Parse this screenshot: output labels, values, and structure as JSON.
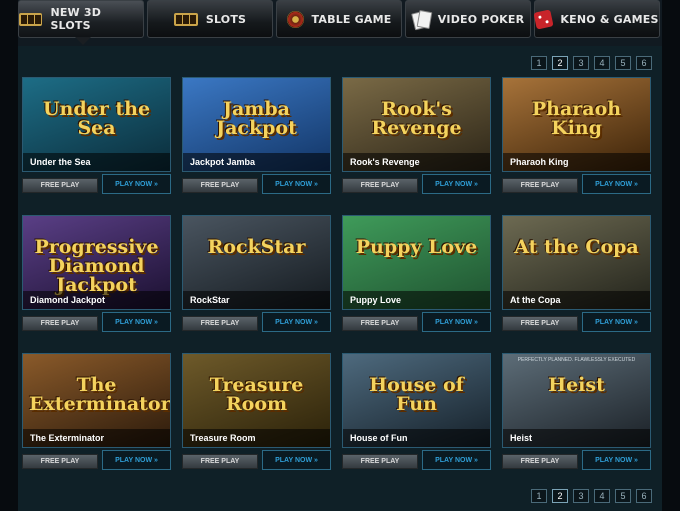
{
  "nav": {
    "tabs": [
      {
        "label": "New 3D Slots",
        "icon": "slot-777-icon",
        "active": true
      },
      {
        "label": "Slots",
        "icon": "slot-777-icon",
        "active": false
      },
      {
        "label": "Table Game",
        "icon": "roulette-icon",
        "active": false
      },
      {
        "label": "Video Poker",
        "icon": "cards-icon",
        "active": false
      },
      {
        "label": "Keno & Games",
        "icon": "dice-icon",
        "active": false
      }
    ]
  },
  "pagination": {
    "pages": [
      "1",
      "2",
      "3",
      "4",
      "5",
      "6"
    ],
    "current": "2"
  },
  "games": [
    {
      "title": "Under the Sea",
      "logo": "Under the Sea",
      "free_label": "FREE PLAY",
      "play_label": "PLAY NOW »",
      "bg_from": "#1d6d86",
      "bg_to": "#0b2c3a"
    },
    {
      "title": "Jackpot Jamba",
      "logo": "Jamba Jackpot",
      "free_label": "FREE PLAY",
      "play_label": "PLAY NOW »",
      "bg_from": "#3b78c4",
      "bg_to": "#123566"
    },
    {
      "title": "Rook's Revenge",
      "logo": "Rook's Revenge",
      "free_label": "FREE PLAY",
      "play_label": "PLAY NOW »",
      "bg_from": "#7a6a46",
      "bg_to": "#2c2517"
    },
    {
      "title": "Pharaoh King",
      "logo": "Pharaoh King",
      "free_label": "FREE PLAY",
      "play_label": "PLAY NOW »",
      "bg_from": "#a7733a",
      "bg_to": "#3b2208"
    },
    {
      "title": "Diamond Jackpot",
      "logo": "Progressive Diamond Jackpot",
      "free_label": "FREE PLAY",
      "play_label": "PLAY NOW »",
      "bg_from": "#5a3f86",
      "bg_to": "#1b1030"
    },
    {
      "title": "RockStar",
      "logo": "RockStar",
      "free_label": "FREE PLAY",
      "play_label": "PLAY NOW »",
      "bg_from": "#4a5560",
      "bg_to": "#141a1f"
    },
    {
      "title": "Puppy Love",
      "logo": "Puppy Love",
      "free_label": "FREE PLAY",
      "play_label": "PLAY NOW »",
      "bg_from": "#3f9b5a",
      "bg_to": "#1f5230"
    },
    {
      "title": "At the Copa",
      "logo": "At the Copa",
      "free_label": "FREE PLAY",
      "play_label": "PLAY NOW »",
      "bg_from": "#6d6a52",
      "bg_to": "#22231b"
    },
    {
      "title": "The Exterminator",
      "logo": "The Exterminator",
      "free_label": "FREE PLAY",
      "play_label": "PLAY NOW »",
      "bg_from": "#8a5a2a",
      "bg_to": "#2b1a0b"
    },
    {
      "title": "Treasure Room",
      "logo": "Treasure Room",
      "free_label": "FREE PLAY",
      "play_label": "PLAY NOW »",
      "bg_from": "#6e5a2a",
      "bg_to": "#2a2109"
    },
    {
      "title": "House of Fun",
      "logo": "House of Fun",
      "free_label": "FREE PLAY",
      "play_label": "PLAY NOW »",
      "bg_from": "#4e6a7e",
      "bg_to": "#152029"
    },
    {
      "title": "Heist",
      "logo": "Heist",
      "tagline": "PERFECTLY PLANNED. FLAWLESSLY EXECUTED",
      "free_label": "FREE PLAY",
      "play_label": "PLAY NOW »",
      "bg_from": "#5d6d78",
      "bg_to": "#1a2026"
    }
  ]
}
